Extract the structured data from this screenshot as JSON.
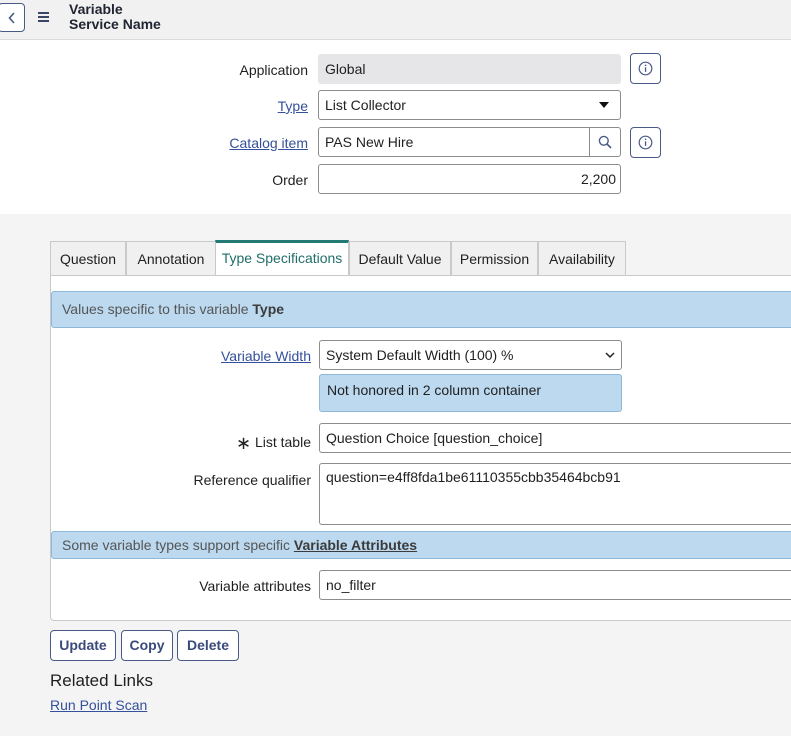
{
  "header": {
    "title_line1": "Variable",
    "title_line2": "Service Name"
  },
  "form": {
    "application_label": "Application",
    "application_value": "Global",
    "type_label": "Type",
    "type_value": "List Collector",
    "catalog_item_label": "Catalog item",
    "catalog_item_value": "PAS New Hire",
    "order_label": "Order",
    "order_value": "2,200"
  },
  "tabs": [
    {
      "label": "Question"
    },
    {
      "label": "Annotation"
    },
    {
      "label": "Type Specifications",
      "active": true
    },
    {
      "label": "Default Value"
    },
    {
      "label": "Permission"
    },
    {
      "label": "Availability"
    }
  ],
  "type_specs": {
    "banner_prefix": "Values specific to this variable ",
    "banner_bold": "Type",
    "variable_width_label": "Variable Width",
    "variable_width_value": "System Default Width (100) %",
    "width_note": "Not honored in 2 column container",
    "list_table_label": "List table",
    "list_table_value": "Question Choice [question_choice]",
    "reference_qualifier_label": "Reference qualifier",
    "reference_qualifier_value": "question=e4ff8fda1be61110355cbb35464bcb91",
    "attributes_banner_prefix": "Some variable types support specific ",
    "attributes_banner_link": "Variable Attributes",
    "variable_attributes_label": "Variable attributes",
    "variable_attributes_value": "no_filter"
  },
  "actions": {
    "update": "Update",
    "copy": "Copy",
    "delete": "Delete"
  },
  "related": {
    "title": "Related Links",
    "link": "Run Point Scan"
  },
  "icons": {
    "back": "chevron-left-icon",
    "menu": "hamburger-menu-icon",
    "info": "info-circle-icon",
    "search": "search-icon",
    "dropdown": "caret-down-icon",
    "required": "asterisk-icon"
  },
  "colors": {
    "accent_tab": "#227a74",
    "info_banner": "#bcd9ef",
    "link": "#34509a",
    "button_border": "#4a5a86"
  }
}
